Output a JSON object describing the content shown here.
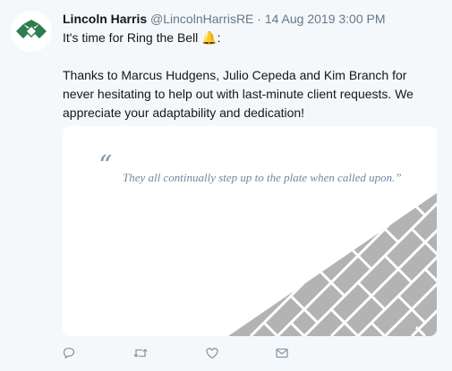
{
  "tweet": {
    "author_name": "Lincoln Harris",
    "handle": "@LincolnHarrisRE",
    "separator": "·",
    "timestamp": "14 Aug 2019 3:00 PM",
    "line1": "It's time for Ring the Bell ",
    "line1_emoji": "🔔",
    "line1_end": ":",
    "paragraph": "Thanks to Marcus Hudgens, Julio Cepeda and Kim Branch for never hesitating to help out with last-minute client requests. We appreciate your adaptability and dedication!"
  },
  "card": {
    "quote_mark": "“",
    "quote": "They all continually step up to the plate when called upon.”"
  },
  "actions": {
    "icons": [
      "reply-icon",
      "retweet-icon",
      "like-icon",
      "message-icon"
    ]
  },
  "colors": {
    "name": "#14171a",
    "meta": "#657786",
    "quote": "#6f89a4",
    "pattern": "#b3b3b3",
    "logo_green": "#2e7d4f",
    "background": "#f5f8fa"
  }
}
